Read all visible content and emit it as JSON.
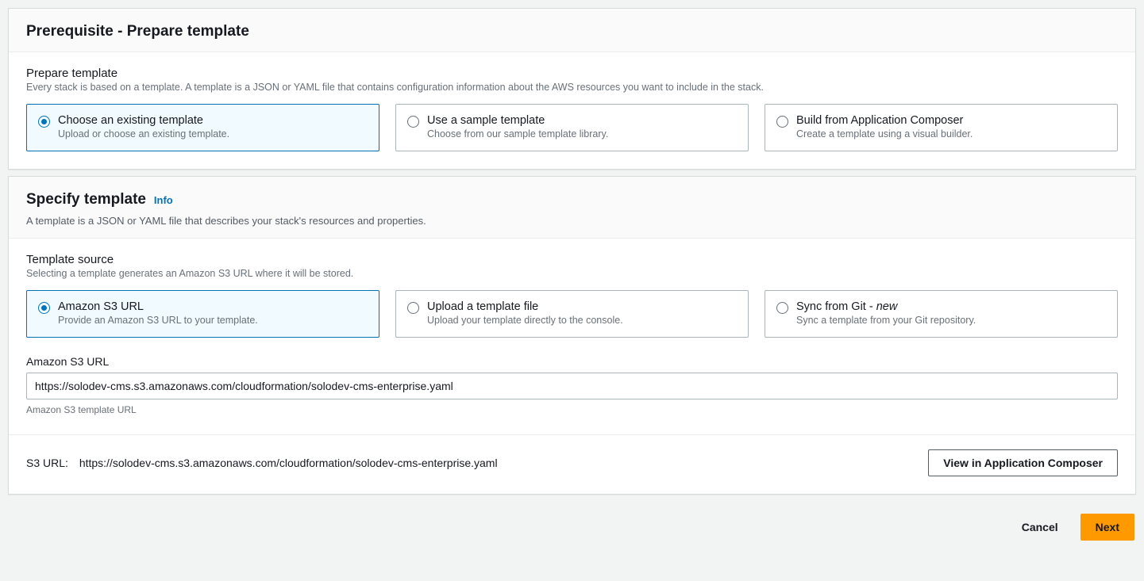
{
  "panel1": {
    "title": "Prerequisite - Prepare template",
    "section_label": "Prepare template",
    "section_desc": "Every stack is based on a template. A template is a JSON or YAML file that contains configuration information about the AWS resources you want to include in the stack.",
    "options": [
      {
        "title": "Choose an existing template",
        "sub": "Upload or choose an existing template."
      },
      {
        "title": "Use a sample template",
        "sub": "Choose from our sample template library."
      },
      {
        "title": "Build from Application Composer",
        "sub": "Create a template using a visual builder."
      }
    ]
  },
  "panel2": {
    "title": "Specify template",
    "info": "Info",
    "subtext": "A template is a JSON or YAML file that describes your stack's resources and properties.",
    "source_label": "Template source",
    "source_desc": "Selecting a template generates an Amazon S3 URL where it will be stored.",
    "options": [
      {
        "title": "Amazon S3 URL",
        "sub": "Provide an Amazon S3 URL to your template."
      },
      {
        "title": "Upload a template file",
        "sub": "Upload your template directly to the console."
      },
      {
        "title_prefix": "Sync from Git - ",
        "title_em": "new",
        "sub": "Sync a template from your Git repository."
      }
    ],
    "url_field_label": "Amazon S3 URL",
    "url_value": "https://solodev-cms.s3.amazonaws.com/cloudformation/solodev-cms-enterprise.yaml",
    "url_hint": "Amazon S3 template URL",
    "s3_label": "S3 URL:",
    "s3_value": "https://solodev-cms.s3.amazonaws.com/cloudformation/solodev-cms-enterprise.yaml",
    "view_btn": "View in Application Composer"
  },
  "footer": {
    "cancel": "Cancel",
    "next": "Next"
  }
}
